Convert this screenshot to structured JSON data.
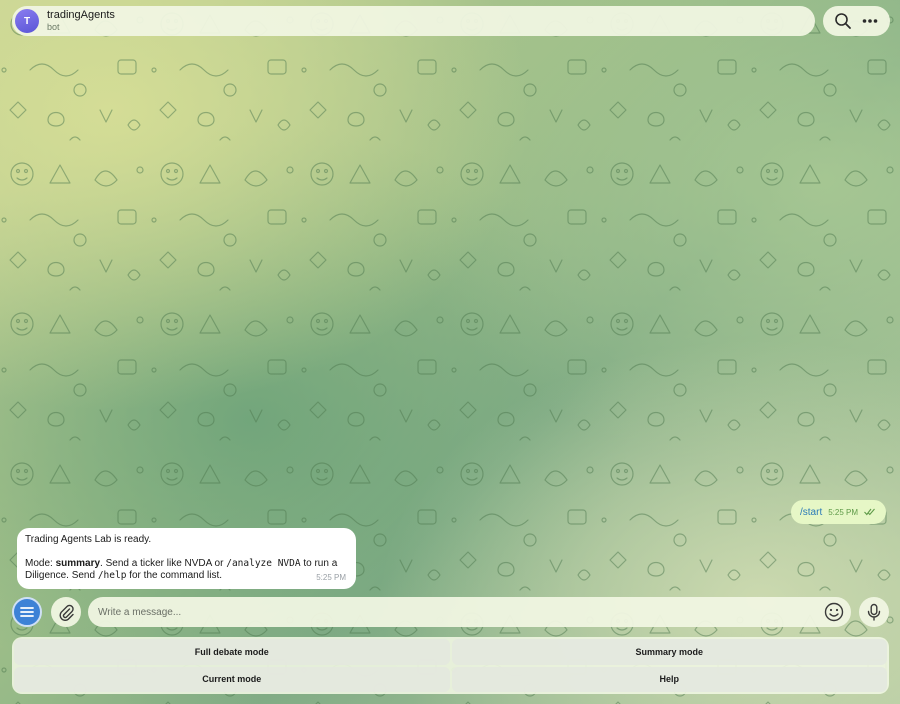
{
  "header": {
    "avatar_letter": "T",
    "title": "tradingAgents",
    "subtitle": "bot",
    "search_icon": "search-icon",
    "more_icon": "more-icon"
  },
  "messages": {
    "outgoing": {
      "text": "/start",
      "time": "5:25 PM",
      "status_icon": "double-check-icon"
    },
    "incoming": {
      "line1": "Trading Agents Lab is ready.",
      "mode_prefix": "Mode: ",
      "mode_value": "summary",
      "mode_text_a": ". Send a ticker like NVDA or ",
      "analyze_cmd": "/analyze NVDA",
      "mode_text_b": " to run a Diligence. Send ",
      "help_cmd": "/help",
      "mode_text_c": " for the command list.",
      "time": "5:25 PM"
    }
  },
  "composer": {
    "placeholder": "Write a message...",
    "menu_icon": "menu-icon",
    "attach_icon": "paperclip-icon",
    "emoji_icon": "emoji-icon",
    "mic_icon": "microphone-icon"
  },
  "keyboard": {
    "buttons": [
      "Full debate mode",
      "Summary mode",
      "Current mode",
      "Help"
    ]
  },
  "colors": {
    "accent": "#3d82d6",
    "outgoing_bubble": "#e6f7c6",
    "incoming_bubble": "#ffffff"
  }
}
